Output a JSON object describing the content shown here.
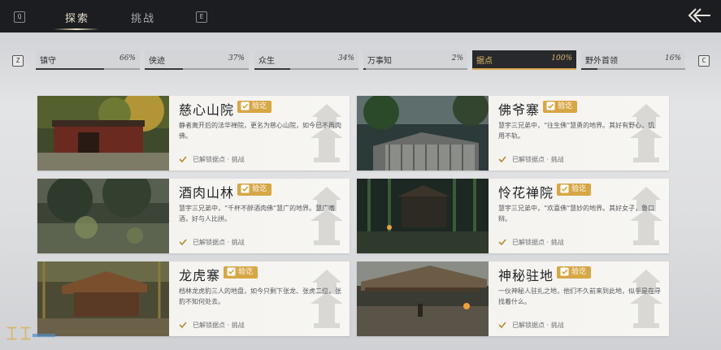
{
  "header": {
    "left_key": "Q",
    "tabs": [
      {
        "label": "探索",
        "active": true
      },
      {
        "label": "挑战",
        "active": false
      }
    ],
    "right_key": "E"
  },
  "filters": {
    "prev_key": "Z",
    "next_key": "C",
    "items": [
      {
        "name": "镇守",
        "percent": "66%",
        "progress": 0.66,
        "active": false
      },
      {
        "name": "侠迹",
        "percent": "37%",
        "progress": 0.37,
        "active": false
      },
      {
        "name": "众生",
        "percent": "34%",
        "progress": 0.34,
        "active": false
      },
      {
        "name": "万事知",
        "percent": "2%",
        "progress": 0.02,
        "active": false
      },
      {
        "name": "据点",
        "percent": "100%",
        "progress": 1.0,
        "active": true
      },
      {
        "name": "野外首领",
        "percent": "16%",
        "progress": 0.16,
        "active": false
      }
    ]
  },
  "badge_label": "验讫",
  "cards": [
    {
      "title": "慈心山院",
      "desc": "静者离开后的法华禅院，更名为慈心山院，如今已不再肉佛。",
      "status": "已解锁据点 · 挑战",
      "scene": "temple"
    },
    {
      "title": "佛爷寨",
      "desc": "慧宇三兄弟中，“往生佛”慧勇的地界。其好有野心，饥用不轨。",
      "status": "已解锁据点 · 挑战",
      "scene": "village"
    },
    {
      "title": "酒肉山林",
      "desc": "慧宇三兄弟中，“千杯不醉酒肉佛”慧广的地界。慧广嗜酒，好与人比拼。",
      "status": "已解锁据点 · 挑战",
      "scene": "forest"
    },
    {
      "title": "怜花禅院",
      "desc": "慧宇三兄弟中，“欢喜佛”慧妙的地界。其好女子，鲁口辩。",
      "status": "已解锁据点 · 挑战",
      "scene": "bamboo"
    },
    {
      "title": "龙虎寨",
      "desc": "档林龙虎豹三人的地盘，如今只剩下张龙、张虎二位，张豹不知何处去。",
      "status": "已解锁据点 · 挑战",
      "scene": "hut"
    },
    {
      "title": "神秘驻地",
      "desc": "一伙神秘人驻扎之地，他们不久前来到此地，似乎是在寻找着什么。",
      "status": "已解锁据点 · 挑战",
      "scene": "camp"
    }
  ],
  "colors": {
    "accent_gold": "#d7a645",
    "topbar_bg": "#1b1d20",
    "active_filter_bg": "#27292c"
  }
}
